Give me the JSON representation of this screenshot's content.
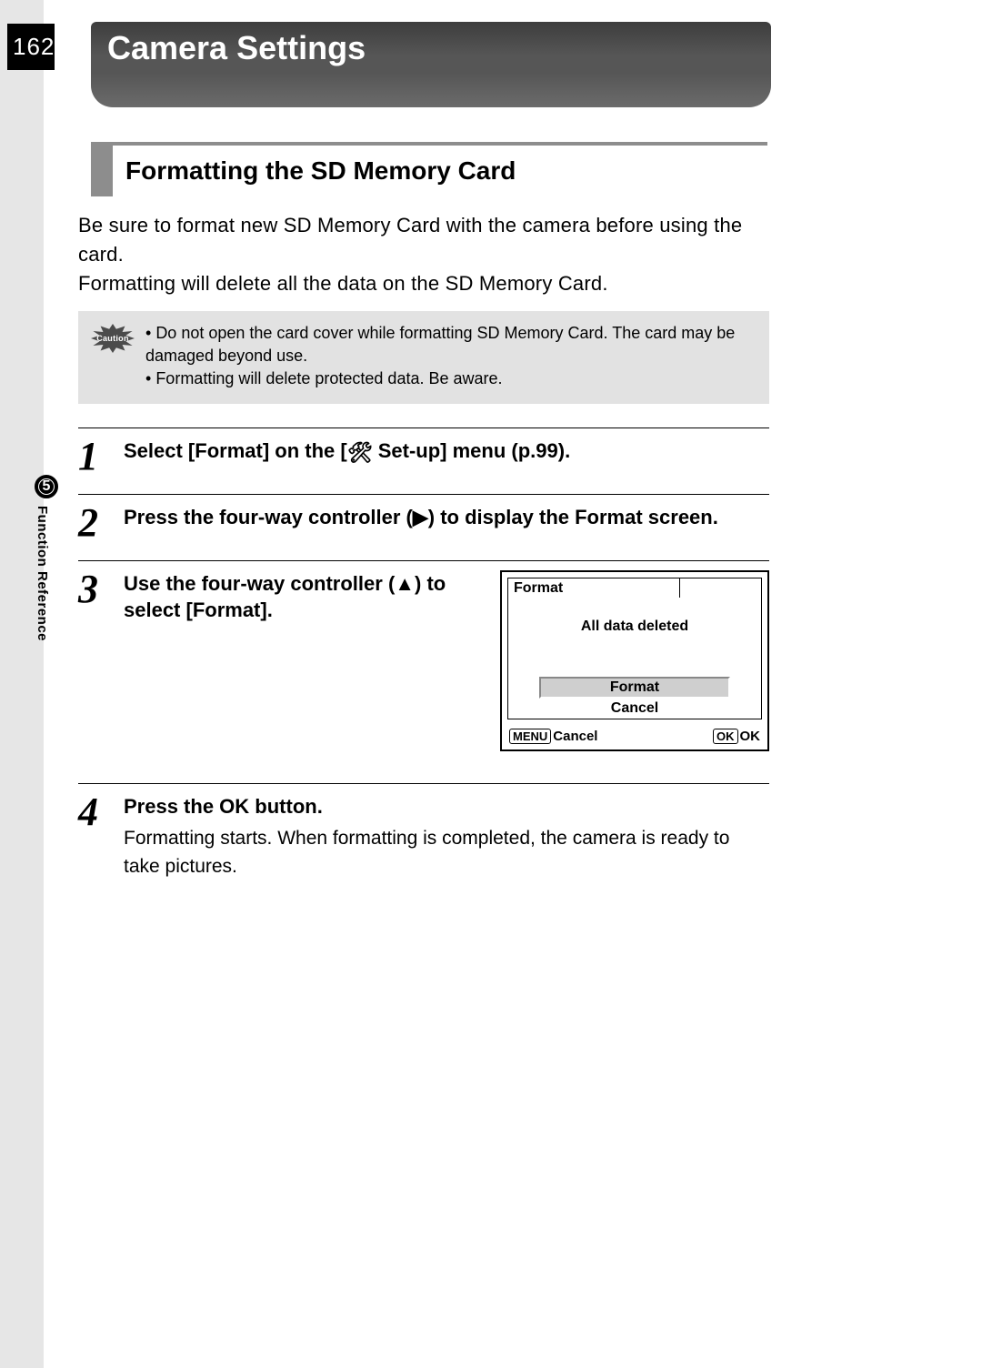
{
  "page_number": "162",
  "chapter_title": "Camera Settings",
  "section_title": "Formatting the SD Memory Card",
  "intro_p1": "Be sure to format new SD Memory Card with the camera before using the card.",
  "intro_p2": "Formatting will delete all the data on the SD Memory Card.",
  "caution_label": "Caution",
  "caution_items": [
    "Do not open the card cover while formatting SD Memory Card. The card may be damaged beyond use.",
    "Formatting will delete protected data. Be aware."
  ],
  "side_tab": {
    "num": "5",
    "label": "Function Reference"
  },
  "steps": [
    {
      "num": "1",
      "title_pre": "Select [Format] on the [",
      "title_icon": "🛠",
      "title_post": " Set-up] menu (p.99)."
    },
    {
      "num": "2",
      "title": "Press the four-way controller (▶) to display the Format screen."
    },
    {
      "num": "3",
      "title": "Use the four-way controller (▲) to select [Format].",
      "lcd": {
        "tab": "Format",
        "message": "All data deleted",
        "option_selected": "Format",
        "option_other": "Cancel",
        "footer_left_key": "MENU",
        "footer_left_label": "Cancel",
        "footer_right_key": "OK",
        "footer_right_label": "OK"
      }
    },
    {
      "num": "4",
      "title_pre": "Press the ",
      "title_ok": "OK",
      "title_post": " button.",
      "desc": "Formatting starts. When formatting is completed, the camera is ready to take pictures."
    }
  ]
}
